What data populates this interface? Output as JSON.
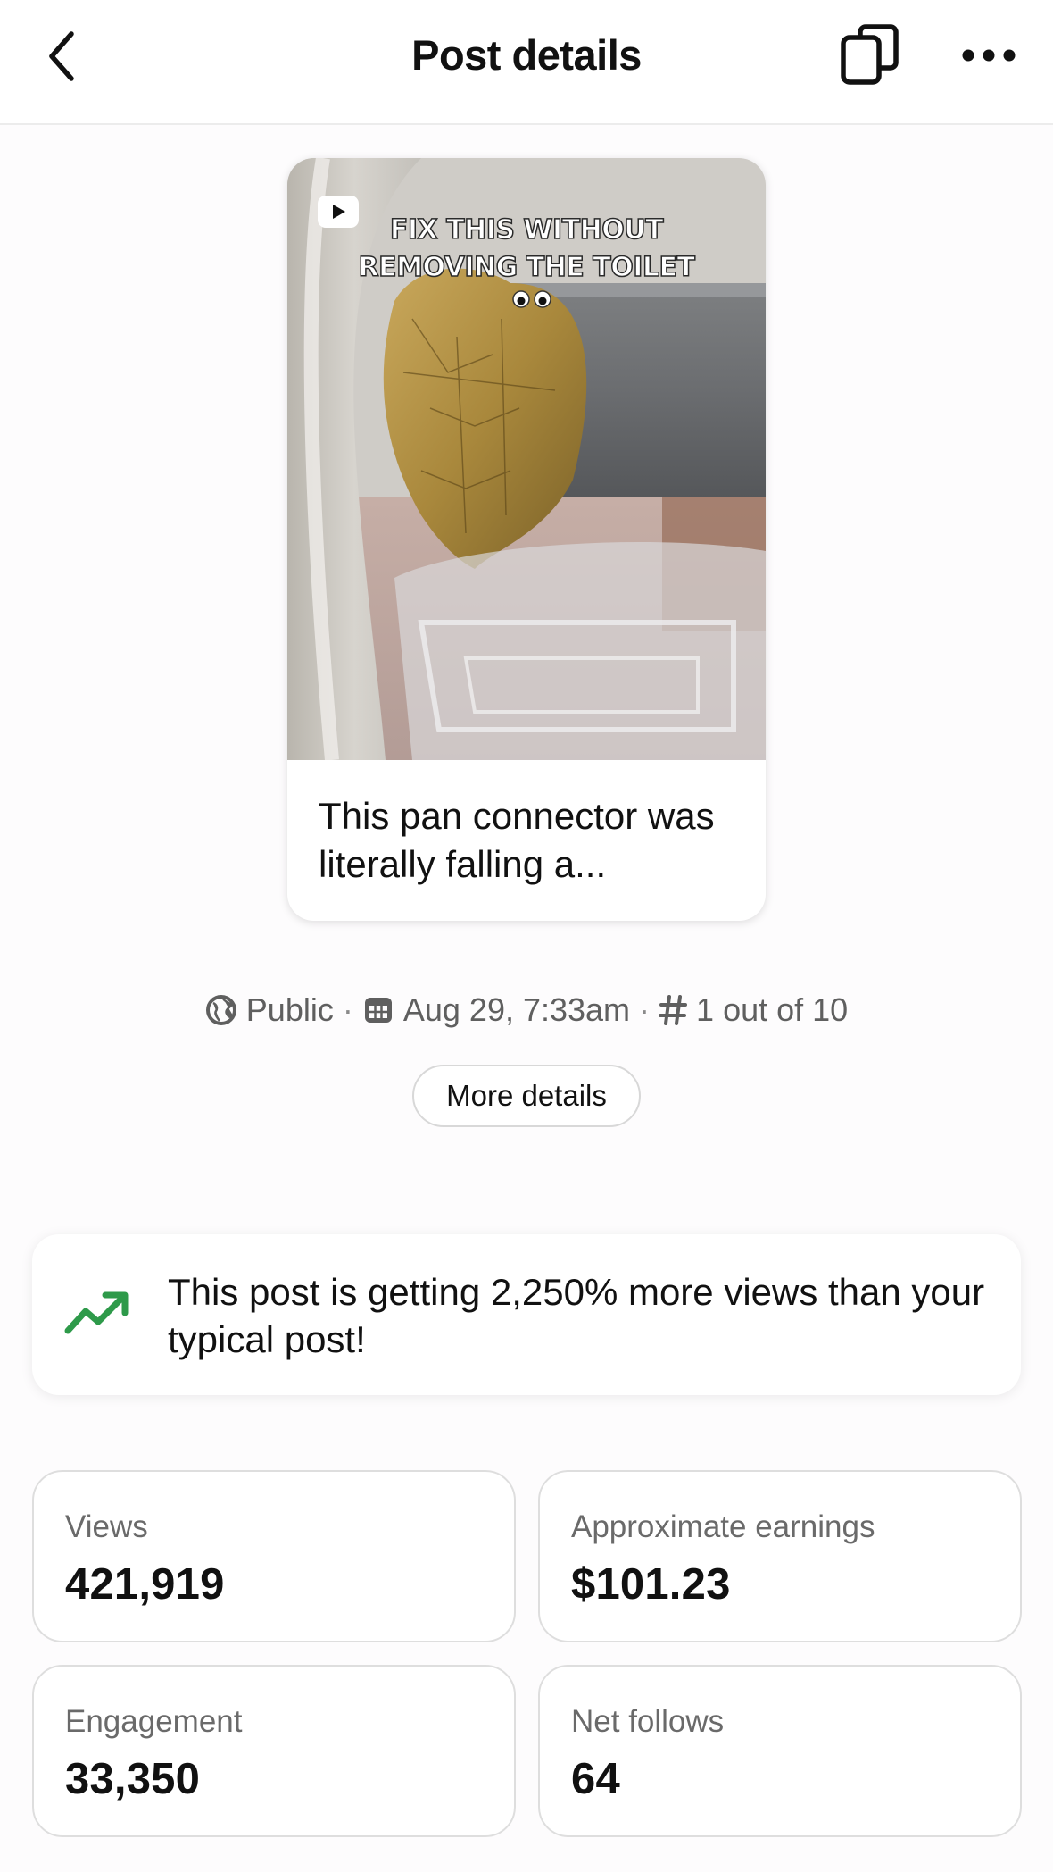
{
  "header": {
    "title": "Post details"
  },
  "pin": {
    "thumbnail_caption_line1": "FIX THIS WITHOUT",
    "thumbnail_caption_line2": "REMOVING THE TOILET",
    "title": "This pan connector was literally falling a..."
  },
  "meta": {
    "visibility": "Public",
    "date": "Aug 29, 7:33am",
    "rank": "1 out of 10",
    "separator": "·"
  },
  "more_details_label": "More details",
  "insight": {
    "text": "This post is getting 2,250% more views than your typical post!",
    "icon": "trending-up-icon",
    "color": "#2e9a4a"
  },
  "stats": {
    "views": {
      "label": "Views",
      "value": "421,919"
    },
    "earnings": {
      "label": "Approximate earnings",
      "value": "$101.23"
    },
    "engagement": {
      "label": "Engagement",
      "value": "33,350"
    },
    "net_follows": {
      "label": "Net follows",
      "value": "64"
    }
  }
}
